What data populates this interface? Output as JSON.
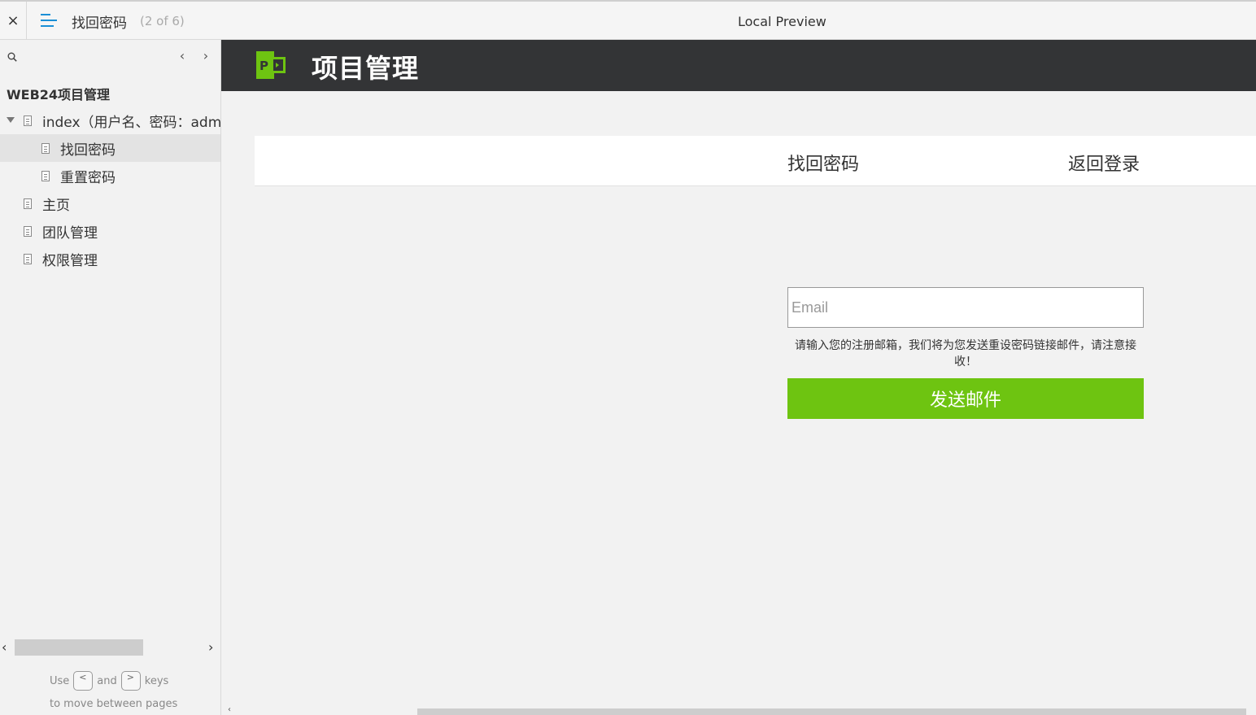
{
  "topbar": {
    "close_label": "×",
    "page_title": "找回密码",
    "page_count": "(2 of 6)",
    "window_title": "Local Preview"
  },
  "sidebar": {
    "prev_label": "‹",
    "next_label": "›",
    "project_name": "WEB24项目管理",
    "items": [
      {
        "label": "index（用户名、密码：admin",
        "level": 0,
        "expanded": true
      },
      {
        "label": "找回密码",
        "level": 1,
        "selected": true
      },
      {
        "label": "重置密码",
        "level": 1
      },
      {
        "label": "主页",
        "level": 0
      },
      {
        "label": "团队管理",
        "level": 0
      },
      {
        "label": "权限管理",
        "level": 0
      }
    ],
    "hint": {
      "use": "Use",
      "prev_key": "<",
      "and": "and",
      "next_key": ">",
      "keys": "keys",
      "line2": "to move between pages"
    }
  },
  "app": {
    "logo_letter": "P",
    "title": "项目管理",
    "panel_title": "找回密码",
    "back_login": "返回登录",
    "email_placeholder": "Email",
    "notice": "请输入您的注册邮箱，我们将为您发送重设密码链接邮件，请注意接收！",
    "send_button": "发送邮件"
  },
  "colors": {
    "header_bg": "#333436",
    "accent_green": "#6ec411",
    "menu_blue": "#1a8fd6"
  }
}
